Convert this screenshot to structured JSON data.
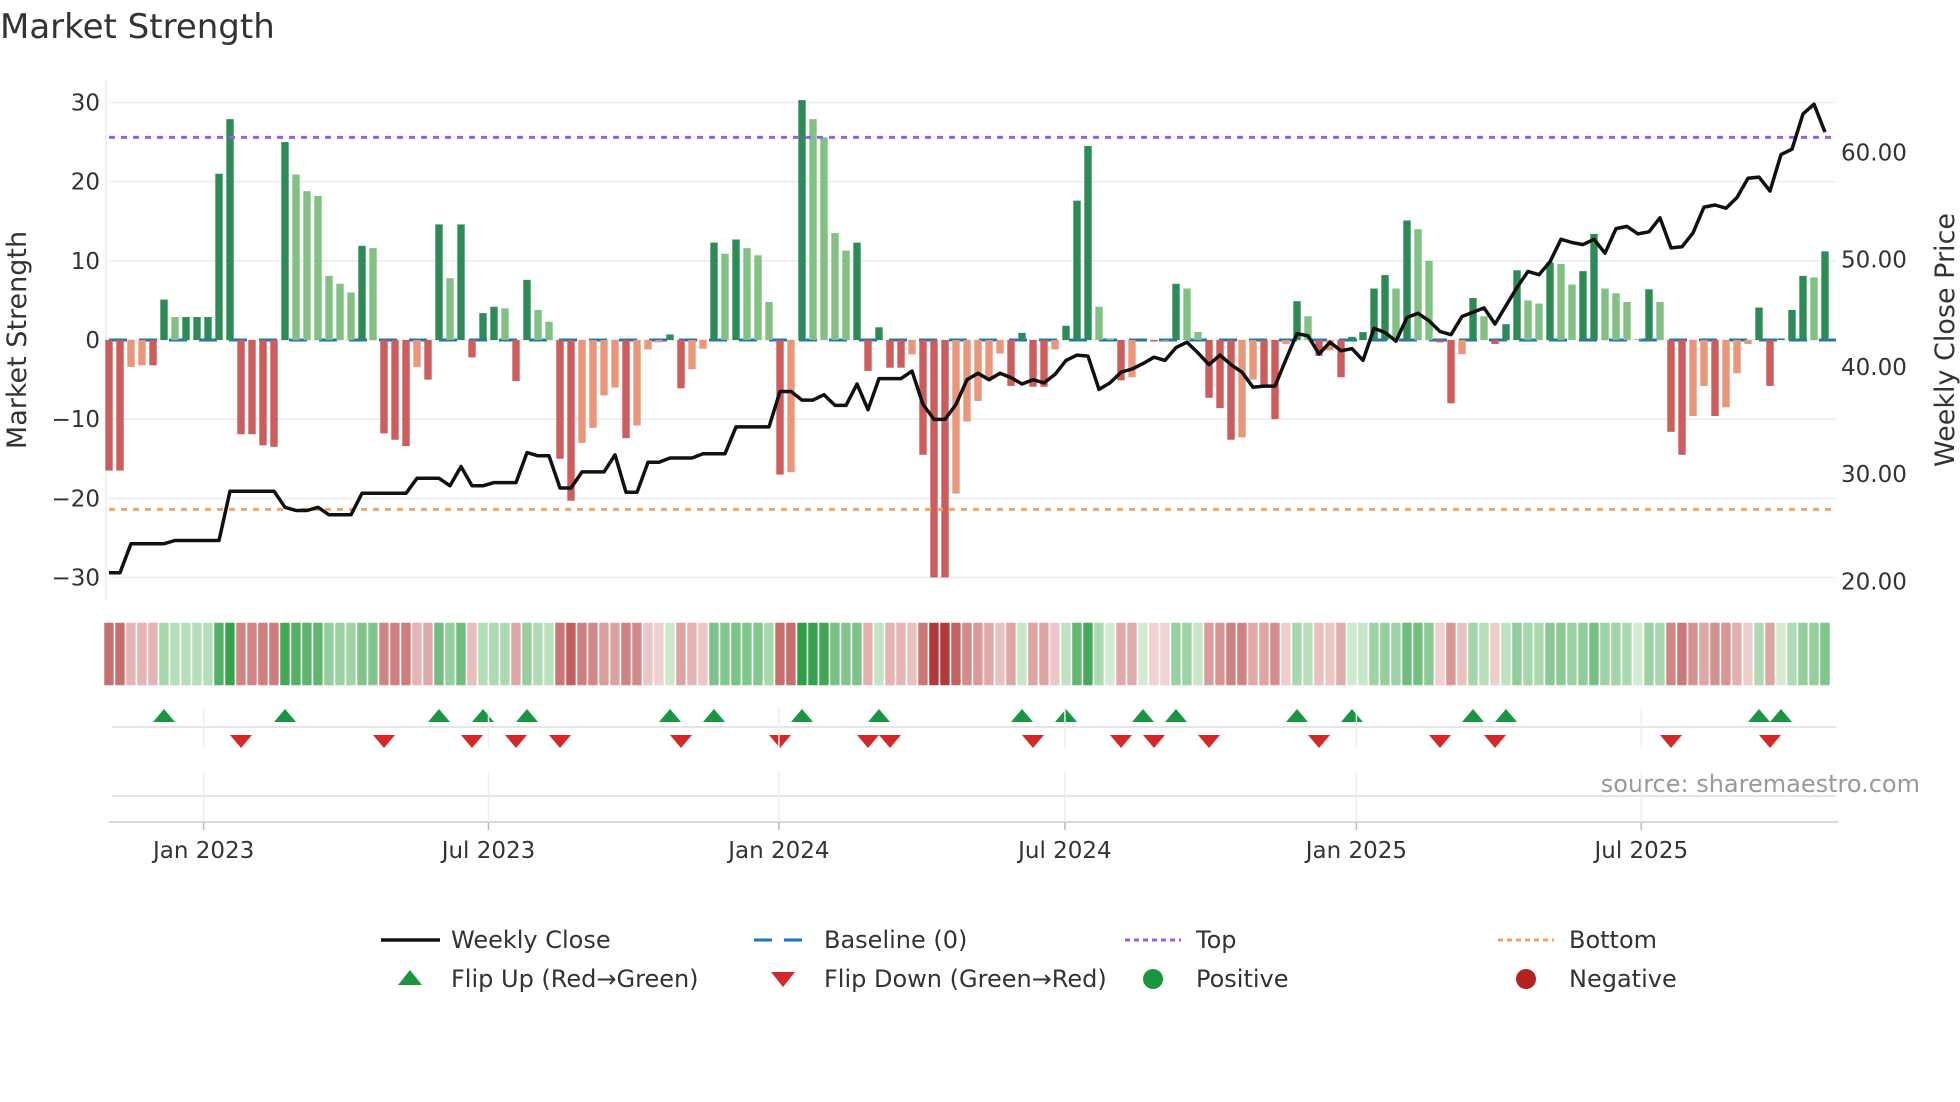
{
  "title": "Market Strength",
  "source": "source: sharemaestro.com",
  "colors": {
    "dark_green": "#2e8b57",
    "light_green": "#82c083",
    "dark_red": "#cd5c5c",
    "light_red": "#e9967a",
    "price": "#111111",
    "baseline": "#1f77b4",
    "top": "#9b5de5",
    "bottom": "#f4a261",
    "flip_up": "#1a9641",
    "flip_down": "#d62728"
  },
  "legend": [
    {
      "label": "Weekly Close",
      "icon": "solid-line"
    },
    {
      "label": "Baseline (0)",
      "icon": "dashed-line"
    },
    {
      "label": "Top",
      "icon": "dotted-line"
    },
    {
      "label": "Bottom",
      "icon": "dotted-line"
    },
    {
      "label": "Flip Up (Red→Green)",
      "icon": "triangle-up"
    },
    {
      "label": "Flip Down (Green→Red)",
      "icon": "triangle-down"
    },
    {
      "label": "Positive",
      "icon": "circle"
    },
    {
      "label": "Negative",
      "icon": "circle"
    }
  ],
  "chart_data": {
    "type": "bar",
    "title": "Market Strength",
    "ylabel": "Market Strength",
    "y2label": "Weekly Close Price",
    "ylim": [
      -30,
      30
    ],
    "y2lim": [
      20.35,
      64.66
    ],
    "yticks": [
      "30",
      "20",
      "10",
      "0",
      "−10",
      "−20",
      "−30"
    ],
    "ytick_values": [
      30,
      20,
      10,
      0,
      -10,
      -20,
      -30
    ],
    "y2ticks": [
      "60.00",
      "50.00",
      "40.00",
      "30.00",
      "20.00"
    ],
    "y2tick_values": [
      60,
      50,
      40,
      30,
      20
    ],
    "xticks": [
      "Jan 2023",
      "Jul 2023",
      "Jan 2024",
      "Jul 2024",
      "Jan 2025",
      "Jul 2025"
    ],
    "xtick_week_index": [
      8.6,
      34.5,
      60.9,
      86.9,
      113.4,
      139.3
    ],
    "top_level": 25.6,
    "bottom_level": -21.4,
    "baseline": 0,
    "strength": [
      -16.5,
      -16.5,
      -3.4,
      -3.2,
      -3.2,
      5.1,
      2.9,
      2.9,
      2.9,
      2.9,
      21,
      27.9,
      -11.9,
      -11.9,
      -13.3,
      -13.5,
      25,
      20.9,
      18.8,
      18.2,
      8.1,
      7.1,
      6.0,
      11.9,
      11.6,
      -11.8,
      -12.6,
      -13.4,
      -3.4,
      -5,
      14.6,
      7.8,
      14.6,
      -2.2,
      3.4,
      4.2,
      4.0,
      -5.2,
      7.6,
      3.8,
      2.3,
      -15,
      -20.3,
      -13,
      -11.1,
      -7,
      -6,
      -12.4,
      -10.8,
      -1.2,
      -0.3,
      0.7,
      -6.1,
      -3.7,
      -1.1,
      12.3,
      10.9,
      12.7,
      11.6,
      10.7,
      4.8,
      -17,
      -16.7,
      30.3,
      27.9,
      25.6,
      13.5,
      11.3,
      12.3,
      -3.9,
      1.6,
      -3.5,
      -3.5,
      -1.8,
      -14.5,
      -30,
      -30,
      -19.4,
      -10.3,
      -7.7,
      -4.9,
      -1.7,
      -5.8,
      0.9,
      -5.9,
      -5.9,
      -1.2,
      1.8,
      17.6,
      24.5,
      4.2,
      0.2,
      -5.1,
      -4.7,
      0.2,
      -0.2,
      -0.1,
      7.1,
      6.5,
      1,
      -7.3,
      -8.6,
      -12.6,
      -12.3,
      -5,
      -5.8,
      -10,
      -0.5,
      4.9,
      3,
      -2,
      -1.3,
      -4.7,
      0.4,
      1,
      6.5,
      8.2,
      6.5,
      15.1,
      14,
      10,
      -0.3,
      -8,
      -1.8,
      5.3,
      3,
      -0.5,
      2,
      8.8,
      5,
      4.6,
      9.8,
      9.6,
      7,
      8.7,
      13.4,
      6.5,
      5.9,
      4.8,
      0.1,
      6.4,
      4.8,
      -11.6,
      -14.5,
      -9.6,
      -5.8,
      -9.6,
      -8.5,
      -4.2,
      -0.5,
      4.1,
      -5.8,
      0.2,
      3.8,
      8.1,
      7.9,
      11.2
    ],
    "weekly_close": [
      20.8,
      20.8,
      23.5,
      23.5,
      23.5,
      23.5,
      23.8,
      23.8,
      23.8,
      23.8,
      23.8,
      28.4,
      28.4,
      28.4,
      28.4,
      28.4,
      26.9,
      26.6,
      26.6,
      26.9,
      26.2,
      26.2,
      26.2,
      28.2,
      28.2,
      28.2,
      28.2,
      28.2,
      29.6,
      29.6,
      29.6,
      28.9,
      30.7,
      28.9,
      28.9,
      29.2,
      29.2,
      29.2,
      32.0,
      31.7,
      31.7,
      28.7,
      28.7,
      30.2,
      30.2,
      30.2,
      31.8,
      28.3,
      28.3,
      31.1,
      31.1,
      31.5,
      31.5,
      31.5,
      31.9,
      31.9,
      31.9,
      34.4,
      34.4,
      34.4,
      34.4,
      37.7,
      37.7,
      36.9,
      36.9,
      37.4,
      36.4,
      36.4,
      38.4,
      36.0,
      38.9,
      38.9,
      38.9,
      39.6,
      36.5,
      35.1,
      35.1,
      36.5,
      38.8,
      39.4,
      38.8,
      39.4,
      39.0,
      38.4,
      38.8,
      38.5,
      39.3,
      40.6,
      41.1,
      41.0,
      37.9,
      38.5,
      39.5,
      39.8,
      40.3,
      40.9,
      40.6,
      41.8,
      42.3,
      41.3,
      40.2,
      41.1,
      40.2,
      39.5,
      38.1,
      38.2,
      38.2,
      40.7,
      43.1,
      42.9,
      41.2,
      42.3,
      41.5,
      41.7,
      40.6,
      43.6,
      43.2,
      42.4,
      44.6,
      45.0,
      44.3,
      43.3,
      43.0,
      44.7,
      45.1,
      45.5,
      44.0,
      45.7,
      47.4,
      48.9,
      48.6,
      49.8,
      51.9,
      51.6,
      51.4,
      51.9,
      50.6,
      52.9,
      53.1,
      52.4,
      52.6,
      53.9,
      51.1,
      51.2,
      52.5,
      54.9,
      55.1,
      54.8,
      55.8,
      57.6,
      57.7,
      56.4,
      59.8,
      60.3,
      63.6,
      64.5,
      61.9
    ],
    "flip_up_week_index": [
      5,
      16,
      30,
      34,
      38,
      51,
      55,
      63,
      70,
      83,
      87,
      94,
      97,
      108,
      113,
      124,
      127,
      150,
      152
    ],
    "flip_down_week_index": [
      12,
      25,
      33,
      37,
      41,
      52,
      61,
      69,
      71,
      84,
      92,
      95,
      100,
      110,
      121,
      126,
      142,
      151
    ]
  }
}
